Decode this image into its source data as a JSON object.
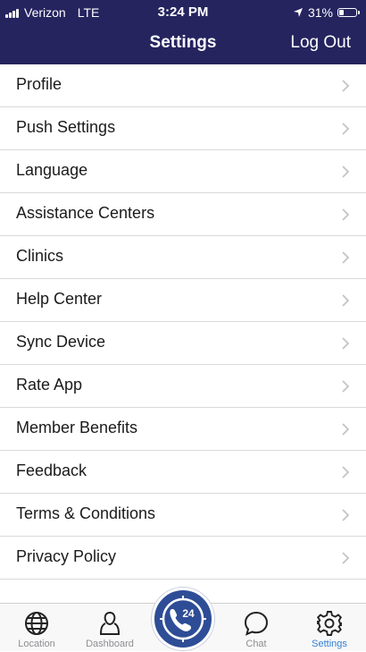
{
  "status_bar": {
    "carrier": "Verizon",
    "network": "LTE",
    "time": "3:24 PM",
    "battery": "31%",
    "battery_level": 0.31
  },
  "nav": {
    "title": "Settings",
    "logout_label": "Log Out"
  },
  "settings": {
    "items": [
      {
        "label": "Profile"
      },
      {
        "label": "Push Settings"
      },
      {
        "label": "Language"
      },
      {
        "label": "Assistance Centers"
      },
      {
        "label": "Clinics"
      },
      {
        "label": "Help Center"
      },
      {
        "label": "Sync Device"
      },
      {
        "label": "Rate App"
      },
      {
        "label": "Member Benefits"
      },
      {
        "label": "Feedback"
      },
      {
        "label": "Terms & Conditions"
      },
      {
        "label": "Privacy Policy"
      }
    ]
  },
  "tabbar": {
    "location_label": "Location",
    "dashboard_label": "Dashboard",
    "center_badge": "24",
    "chat_label": "Chat",
    "settings_label": "Settings",
    "active_color": "#2f80d6",
    "inactive_color": "#8e8e93"
  },
  "colors": {
    "header_bg": "#25245f",
    "center_button": "#2e4d96"
  }
}
